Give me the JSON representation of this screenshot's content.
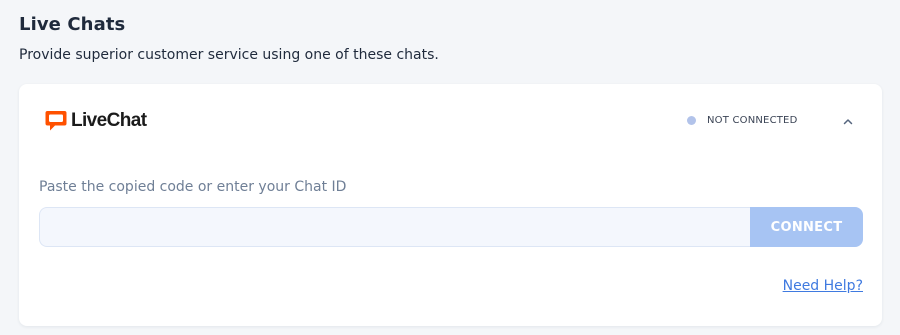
{
  "page": {
    "title": "Live Chats",
    "subtitle": "Provide superior customer service using one of these chats."
  },
  "card": {
    "brand": {
      "name": "LiveChat",
      "logo_icon": "livechat-speech-bubble-icon",
      "logo_color": "#ff5100"
    },
    "status": {
      "label": "NOT CONNECTED",
      "dot_color": "#b2c3ea"
    },
    "toggle_icon": "chevron-up-icon",
    "field": {
      "label": "Paste the copied code or enter your Chat ID",
      "value": "",
      "placeholder": ""
    },
    "connect_label": "CONNECT",
    "connect_color": "#a7c4f3",
    "help_link": "Need Help?"
  }
}
